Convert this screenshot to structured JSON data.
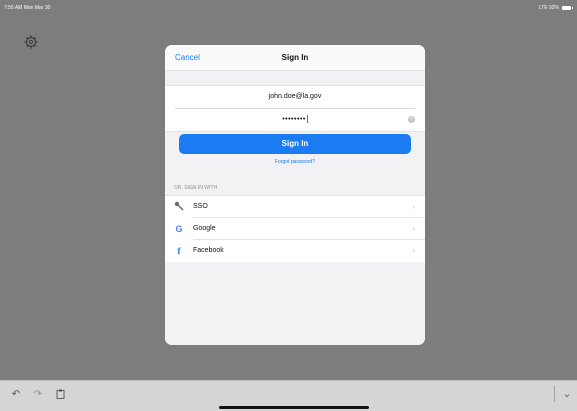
{
  "status_bar": {
    "time": "7:55 AM  Mon Mar 30",
    "network": "LTE 92%"
  },
  "modal": {
    "cancel_label": "Cancel",
    "title": "Sign In",
    "email_value": "john.doe@la.gov",
    "password_mask": "••••••••",
    "sign_in_label": "Sign In",
    "forgot_label": "Forgot password?",
    "or_label": "OR, SIGN IN WITH",
    "providers": [
      {
        "label": "SSO",
        "icon": "key-icon"
      },
      {
        "label": "Google",
        "icon": "google-icon"
      },
      {
        "label": "Facebook",
        "icon": "facebook-icon"
      }
    ]
  },
  "colors": {
    "accent": "#1a7bf2",
    "backdrop": "#7d7d80"
  }
}
